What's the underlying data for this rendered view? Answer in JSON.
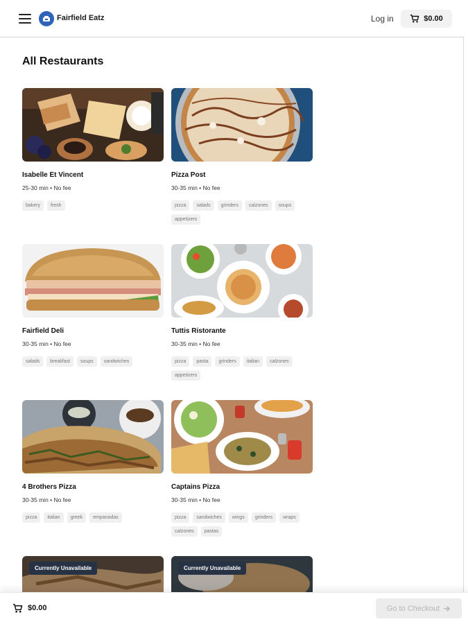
{
  "header": {
    "brand": "Fairfield Eatz",
    "login_label": "Log in",
    "cart_total": "$0.00",
    "menu_icon": "hamburger-menu-icon",
    "cart_icon": "shopping-cart-icon"
  },
  "page": {
    "title": "All Restaurants"
  },
  "restaurants": [
    {
      "name": "Isabelle Et Vincent",
      "meta": "25-30 min • No fee",
      "tags": [
        "bakery",
        "fresh"
      ],
      "unavailable": false
    },
    {
      "name": "Pizza Post",
      "meta": "30-35 min • No fee",
      "tags": [
        "pizza",
        "salads",
        "grinders",
        "calzones",
        "soups",
        "appetizers"
      ],
      "unavailable": false
    },
    {
      "name": "Fairfield Deli",
      "meta": "30-35 min • No fee",
      "tags": [
        "salads",
        "breakfast",
        "soups",
        "sandwiches"
      ],
      "unavailable": false
    },
    {
      "name": "Tuttis Ristorante",
      "meta": "30-35 min • No fee",
      "tags": [
        "pizza",
        "pasta",
        "grinders",
        "italian",
        "calzones",
        "appetizers"
      ],
      "unavailable": false
    },
    {
      "name": "4 Brothers Pizza",
      "meta": "30-35 min • No fee",
      "tags": [
        "pizza",
        "italian",
        "greek",
        "empanadas"
      ],
      "unavailable": false
    },
    {
      "name": "Captains Pizza",
      "meta": "30-35 min • No fee",
      "tags": [
        "pizza",
        "sandwiches",
        "wings",
        "grinders",
        "wraps",
        "calzones",
        "pastas"
      ],
      "unavailable": false
    },
    {
      "status_label": "Currently Unavailable",
      "unavailable": true
    },
    {
      "status_label": "Currently Unavailable",
      "unavailable": true
    }
  ],
  "bottom_bar": {
    "cart_total": "$0.00",
    "checkout_label": "Go to Checkout",
    "checkout_icon": "arrow-right-icon"
  },
  "colors": {
    "brand_blue": "#2e63b8",
    "unavailable_badge": "#273244",
    "tag_bg": "#f0f0f0"
  }
}
